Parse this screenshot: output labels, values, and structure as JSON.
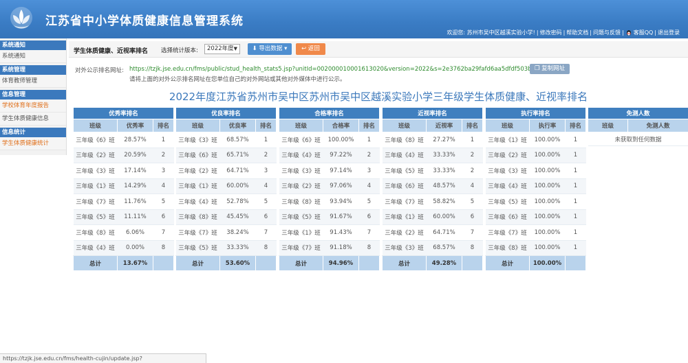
{
  "app": {
    "title": "江苏省中小学体质健康信息管理系统"
  },
  "userbar": {
    "welcome": "欢迎您: 苏州市吴中区越溪实验小学!",
    "links": [
      "修改密码",
      "帮助文档",
      "问题与反馈",
      "客服QQ",
      "退出登录"
    ],
    "separator": "|"
  },
  "sidebar": {
    "groups": [
      {
        "label": "系统通知",
        "items": [
          {
            "label": "系统通知",
            "active": false
          }
        ]
      },
      {
        "label": "系统管理",
        "items": [
          {
            "label": "体育教师管理",
            "active": false
          }
        ]
      },
      {
        "label": "信息管理",
        "items": [
          {
            "label": "学校体育年度报告",
            "active": true
          },
          {
            "label": "学生体质健康信息",
            "active": false
          }
        ]
      },
      {
        "label": "信息统计",
        "items": [
          {
            "label": "学生体质健康统计",
            "active": true
          }
        ]
      }
    ]
  },
  "toolbar": {
    "page_title": "学生体质健康、近视率排名",
    "version_label": "选择统计版本:",
    "version_value": "2022年度",
    "export_label": "导出数据",
    "back_label": "返回"
  },
  "public_url": {
    "label": "对外公示排名网址:",
    "url": "https://tzjk.jse.edu.cn/fms/public/stud_health_stats5.jsp?unitId=00200001000161302​0&version=2022&s=2e3762ba29fafd6aa5dfdf503b19c919",
    "copy_label": "复制网址",
    "note": "请将上面的对外公示排名网址在您单位自己的对外网站或其他对外媒体中进行公示。"
  },
  "heading": "2022年度江苏省苏州市吴中区苏州市吴中区越溪实验小学三年级学生体质健康、近视率排名",
  "tables": [
    {
      "title": "优秀率排名",
      "headers": [
        "班级",
        "优秀率",
        "排名"
      ],
      "rows": [
        [
          "三年级《6》班",
          "28.57%",
          "1"
        ],
        [
          "三年级《2》班",
          "20.59%",
          "2"
        ],
        [
          "三年级《3》班",
          "17.14%",
          "3"
        ],
        [
          "三年级《1》班",
          "14.29%",
          "4"
        ],
        [
          "三年级《7》班",
          "11.76%",
          "5"
        ],
        [
          "三年级《5》班",
          "11.11%",
          "6"
        ],
        [
          "三年级《8》班",
          "6.06%",
          "7"
        ],
        [
          "三年级《4》班",
          "0.00%",
          "8"
        ]
      ],
      "total_label": "总计",
      "total_value": "13.67%"
    },
    {
      "title": "优良率排名",
      "headers": [
        "班级",
        "优良率",
        "排名"
      ],
      "rows": [
        [
          "三年级《3》班",
          "68.57%",
          "1"
        ],
        [
          "三年级《6》班",
          "65.71%",
          "2"
        ],
        [
          "三年级《2》班",
          "64.71%",
          "3"
        ],
        [
          "三年级《1》班",
          "60.00%",
          "4"
        ],
        [
          "三年级《4》班",
          "52.78%",
          "5"
        ],
        [
          "三年级《8》班",
          "45.45%",
          "6"
        ],
        [
          "三年级《7》班",
          "38.24%",
          "7"
        ],
        [
          "三年级《5》班",
          "33.33%",
          "8"
        ]
      ],
      "total_label": "总计",
      "total_value": "53.60%"
    },
    {
      "title": "合格率排名",
      "headers": [
        "班级",
        "合格率",
        "排名"
      ],
      "rows": [
        [
          "三年级《6》班",
          "100.00%",
          "1"
        ],
        [
          "三年级《4》班",
          "97.22%",
          "2"
        ],
        [
          "三年级《3》班",
          "97.14%",
          "3"
        ],
        [
          "三年级《2》班",
          "97.06%",
          "4"
        ],
        [
          "三年级《8》班",
          "93.94%",
          "5"
        ],
        [
          "三年级《5》班",
          "91.67%",
          "6"
        ],
        [
          "三年级《1》班",
          "91.43%",
          "7"
        ],
        [
          "三年级《7》班",
          "91.18%",
          "8"
        ]
      ],
      "total_label": "总计",
      "total_value": "94.96%"
    },
    {
      "title": "近视率排名",
      "headers": [
        "班级",
        "近视率",
        "排名"
      ],
      "rows": [
        [
          "三年级《8》班",
          "27.27%",
          "1"
        ],
        [
          "三年级《4》班",
          "33.33%",
          "2"
        ],
        [
          "三年级《5》班",
          "33.33%",
          "2"
        ],
        [
          "三年级《6》班",
          "48.57%",
          "4"
        ],
        [
          "三年级《7》班",
          "58.82%",
          "5"
        ],
        [
          "三年级《1》班",
          "60.00%",
          "6"
        ],
        [
          "三年级《2》班",
          "64.71%",
          "7"
        ],
        [
          "三年级《3》班",
          "68.57%",
          "8"
        ]
      ],
      "total_label": "总计",
      "total_value": "49.28%"
    },
    {
      "title": "执行率排名",
      "headers": [
        "班级",
        "执行率",
        "排名"
      ],
      "rows": [
        [
          "三年级《1》班",
          "100.00%",
          "1"
        ],
        [
          "三年级《2》班",
          "100.00%",
          "1"
        ],
        [
          "三年级《3》班",
          "100.00%",
          "1"
        ],
        [
          "三年级《4》班",
          "100.00%",
          "1"
        ],
        [
          "三年级《5》班",
          "100.00%",
          "1"
        ],
        [
          "三年级《6》班",
          "100.00%",
          "1"
        ],
        [
          "三年级《7》班",
          "100.00%",
          "1"
        ],
        [
          "三年级《8》班",
          "100.00%",
          "1"
        ]
      ],
      "total_label": "总计",
      "total_value": "100.00%"
    },
    {
      "title": "免测人数",
      "headers": [
        "班级",
        "免测人数"
      ],
      "rows": [],
      "empty_text": "未获取到任何数据"
    }
  ],
  "status_bar": "https://tzjk.jse.edu.cn/fms/health-cujin/update.jsp?objectTypeId=sportseval",
  "colors": {
    "header_bg": "#3a7cc4",
    "table_title": "#3f7fbf",
    "table_head": "#b9d3ec",
    "heading": "#3b78bb",
    "url_green": "#2c8a2c",
    "back_orange": "#f0894a"
  }
}
